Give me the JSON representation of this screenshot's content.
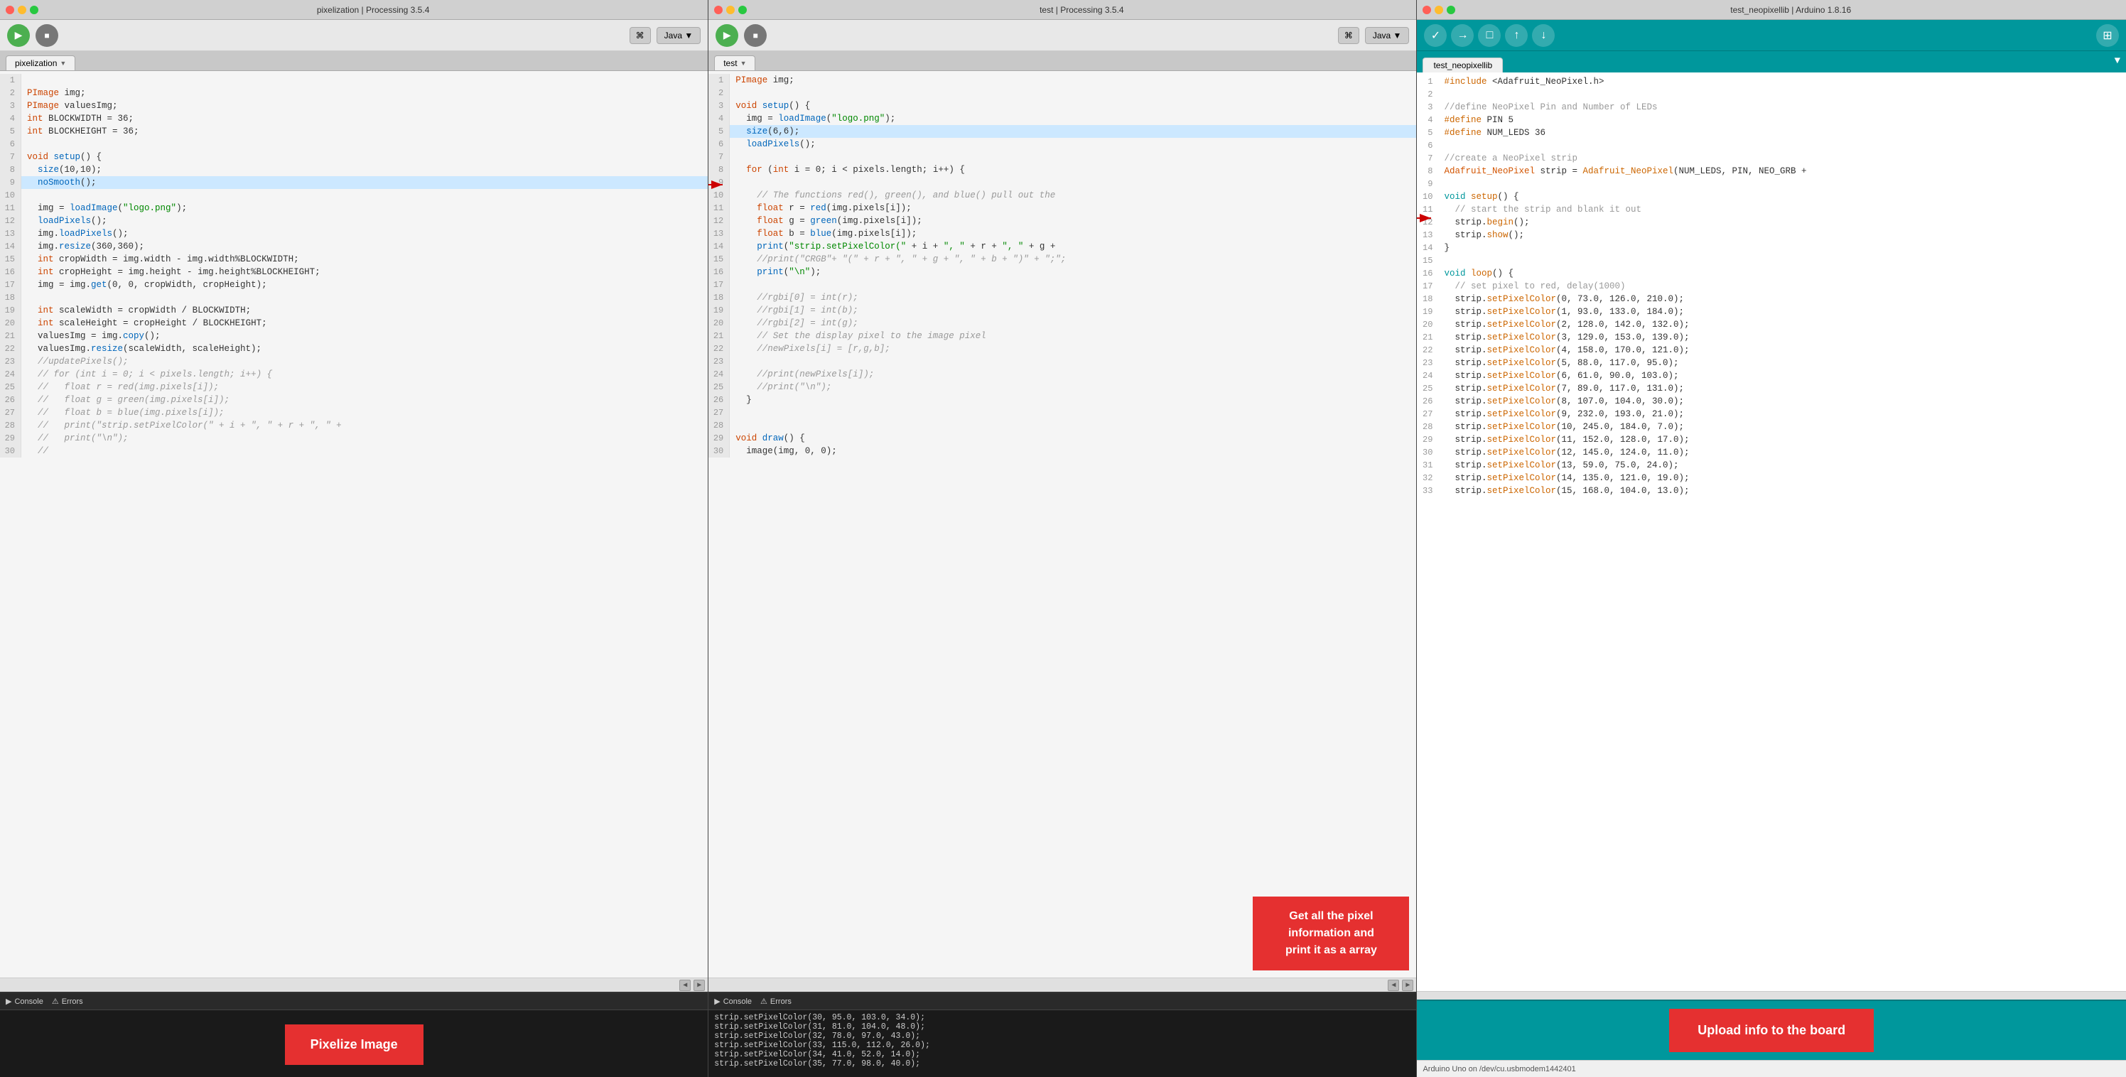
{
  "panels": [
    {
      "id": "processing-left",
      "titlebar": "pixelization | Processing 3.5.4",
      "tab": "pixelization",
      "lang": "Java",
      "lines": [
        {
          "n": 1,
          "text": ""
        },
        {
          "n": 2,
          "text": "PImage img;"
        },
        {
          "n": 3,
          "text": "PImage valuesImg;"
        },
        {
          "n": 4,
          "text": "int BLOCKWIDTH = 36;"
        },
        {
          "n": 5,
          "text": "int BLOCKHEIGHT = 36;"
        },
        {
          "n": 6,
          "text": ""
        },
        {
          "n": 7,
          "text": "void setup() {"
        },
        {
          "n": 8,
          "text": "  size(10,10);"
        },
        {
          "n": 9,
          "text": "  noSmooth();",
          "highlighted": true
        },
        {
          "n": 10,
          "text": ""
        },
        {
          "n": 11,
          "text": "  img = loadImage(\"logo.png\");"
        },
        {
          "n": 12,
          "text": "  loadPixels();"
        },
        {
          "n": 13,
          "text": "  img.loadPixels();"
        },
        {
          "n": 14,
          "text": "  img.resize(360,360);"
        },
        {
          "n": 15,
          "text": "  int cropWidth = img.width - img.width%BLOCKWIDTH;"
        },
        {
          "n": 16,
          "text": "  int cropHeight = img.height - img.height%BLOCKHEIGHT;"
        },
        {
          "n": 17,
          "text": "  img = img.get(0, 0, cropWidth, cropHeight);"
        },
        {
          "n": 18,
          "text": ""
        },
        {
          "n": 19,
          "text": "  int scaleWidth = cropWidth / BLOCKWIDTH;"
        },
        {
          "n": 20,
          "text": "  int scaleHeight = cropHeight / BLOCKHEIGHT;"
        },
        {
          "n": 21,
          "text": "  valuesImg = img.copy();"
        },
        {
          "n": 22,
          "text": "  valuesImg.resize(scaleWidth, scaleHeight);"
        },
        {
          "n": 23,
          "text": "  //updatePixels();"
        },
        {
          "n": 24,
          "text": "  // for (int i = 0; i < pixels.length; i++) {"
        },
        {
          "n": 25,
          "text": "  //   float r = red(img.pixels[i]);"
        },
        {
          "n": 26,
          "text": "  //   float g = green(img.pixels[i]);"
        },
        {
          "n": 27,
          "text": "  //   float b = blue(img.pixels[i]);"
        },
        {
          "n": 28,
          "text": "  //   print(\"strip.setPixelColor(\" + i + \", \" + r + \", \" +"
        },
        {
          "n": 29,
          "text": "  //   print(\"\\n\");"
        },
        {
          "n": 30,
          "text": "  //"
        }
      ]
    },
    {
      "id": "processing-mid",
      "titlebar": "test | Processing 3.5.4",
      "tab": "test",
      "lang": "Java",
      "lines": [
        {
          "n": 1,
          "text": "PImage img;"
        },
        {
          "n": 2,
          "text": ""
        },
        {
          "n": 3,
          "text": "void setup() {"
        },
        {
          "n": 4,
          "text": "  img = loadImage(\"logo.png\");"
        },
        {
          "n": 5,
          "text": "  size(6,6);",
          "highlighted": true
        },
        {
          "n": 6,
          "text": "  loadPixels();"
        },
        {
          "n": 7,
          "text": ""
        },
        {
          "n": 8,
          "text": "  for (int i = 0; i < pixels.length; i++) {"
        },
        {
          "n": 9,
          "text": ""
        },
        {
          "n": 10,
          "text": "    // The functions red(), green(), and blue() pull out the"
        },
        {
          "n": 11,
          "text": "    float r = red(img.pixels[i]);"
        },
        {
          "n": 12,
          "text": "    float g = green(img.pixels[i]);"
        },
        {
          "n": 13,
          "text": "    float b = blue(img.pixels[i]);"
        },
        {
          "n": 14,
          "text": "    print(\"strip.setPixelColor(\" + i + \", \" + r + \", \" + g +"
        },
        {
          "n": 15,
          "text": "    //print(\"CRGB\"+ \"(\" + r + \", \" + g + \", \" + b + \")\" + \";\";"
        },
        {
          "n": 16,
          "text": "    print(\"\\n\");"
        },
        {
          "n": 17,
          "text": ""
        },
        {
          "n": 18,
          "text": "    //rgbi[0] = int(r);"
        },
        {
          "n": 19,
          "text": "    //rgbi[1] = int(b);"
        },
        {
          "n": 20,
          "text": "    //rgbi[2] = int(g);"
        },
        {
          "n": 21,
          "text": "    // Set the display pixel to the image pixel"
        },
        {
          "n": 22,
          "text": "    //newPixels[i] = [r,g,b];"
        },
        {
          "n": 23,
          "text": ""
        },
        {
          "n": 24,
          "text": "    //print(newPixels[i]);"
        },
        {
          "n": 25,
          "text": "    //print(\"\\n\");"
        },
        {
          "n": 26,
          "text": "  }"
        },
        {
          "n": 27,
          "text": ""
        },
        {
          "n": 28,
          "text": ""
        },
        {
          "n": 29,
          "text": "void draw() {"
        },
        {
          "n": 30,
          "text": "  image(img, 0, 0);"
        }
      ],
      "annotation": "Get all the pixel\ninformation and\nprint it as a array",
      "console_lines": [
        "strip.setPixelColor(30, 95.0, 103.0, 34.0);",
        "strip.setPixelColor(31, 81.0, 104.0, 48.0);",
        "strip.setPixelColor(32, 78.0, 97.0, 43.0);",
        "strip.setPixelColor(33, 115.0, 112.0, 26.0);",
        "strip.setPixelColor(34, 41.0, 52.0, 14.0);",
        "strip.setPixelColor(35, 77.0, 98.0, 40.0);"
      ]
    }
  ],
  "arduino": {
    "titlebar": "test_neopixellib | Arduino 1.8.16",
    "tab": "test_neopixellib",
    "lines": [
      {
        "n": 1,
        "text": "#include <Adafruit_NeoPixel.h>"
      },
      {
        "n": 2,
        "text": ""
      },
      {
        "n": 3,
        "text": "//define NeoPixel Pin and Number of LEDs"
      },
      {
        "n": 4,
        "text": "#define PIN 5"
      },
      {
        "n": 5,
        "text": "#define NUM_LEDS 36"
      },
      {
        "n": 6,
        "text": ""
      },
      {
        "n": 7,
        "text": "//create a NeoPixel strip"
      },
      {
        "n": 8,
        "text": "Adafruit_NeoPixel strip = Adafruit_NeoPixel(NUM_LEDS, PIN, NEO_GRB +"
      },
      {
        "n": 9,
        "text": ""
      },
      {
        "n": 10,
        "text": "void setup() {"
      },
      {
        "n": 11,
        "text": "  // start the strip and blank it out"
      },
      {
        "n": 12,
        "text": "  strip.begin();"
      },
      {
        "n": 13,
        "text": "  strip.show();"
      },
      {
        "n": 14,
        "text": "}"
      },
      {
        "n": 15,
        "text": ""
      },
      {
        "n": 16,
        "text": "void loop() {"
      },
      {
        "n": 17,
        "text": "  // set pixel to red, delay(1000)"
      },
      {
        "n": 18,
        "text": "  strip.setPixelColor(0, 73.0, 126.0, 210.0);"
      },
      {
        "n": 19,
        "text": "  strip.setPixelColor(1, 93.0, 133.0, 184.0);"
      },
      {
        "n": 20,
        "text": "  strip.setPixelColor(2, 128.0, 142.0, 132.0);"
      },
      {
        "n": 21,
        "text": "  strip.setPixelColor(3, 129.0, 153.0, 139.0);"
      },
      {
        "n": 22,
        "text": "  strip.setPixelColor(4, 158.0, 170.0, 121.0);"
      },
      {
        "n": 23,
        "text": "  strip.setPixelColor(5, 88.0, 117.0, 95.0);"
      },
      {
        "n": 24,
        "text": "  strip.setPixelColor(6, 61.0, 90.0, 103.0);"
      },
      {
        "n": 25,
        "text": "  strip.setPixelColor(7, 89.0, 117.0, 131.0);"
      },
      {
        "n": 26,
        "text": "  strip.setPixelColor(8, 107.0, 104.0, 30.0);"
      },
      {
        "n": 27,
        "text": "  strip.setPixelColor(9, 232.0, 193.0, 21.0);"
      },
      {
        "n": 28,
        "text": "  strip.setPixelColor(10, 245.0, 184.0, 7.0);"
      },
      {
        "n": 29,
        "text": "  strip.setPixelColor(11, 152.0, 128.0, 17.0);"
      },
      {
        "n": 30,
        "text": "  strip.setPixelColor(12, 145.0, 124.0, 11.0);"
      },
      {
        "n": 31,
        "text": "  strip.setPixelColor(13, 59.0, 75.0, 24.0);"
      },
      {
        "n": 32,
        "text": "  strip.setPixelColor(14, 135.0, 121.0, 19.0);"
      },
      {
        "n": 33,
        "text": "  strip.setPixelColor(15, 168.0, 104.0, 13.0);"
      }
    ],
    "status_bar": "Arduino Uno on /dev/cu.usbmodem1442401",
    "upload_button": "Upload info to the board"
  },
  "buttons": {
    "play_title": "▶",
    "stop_title": "■",
    "pixelize_label": "Pixelize Image",
    "upload_label": "Upload info to the board",
    "console_label": "Console",
    "errors_label": "Errors",
    "debug_label": "⌘",
    "java_label": "Java ▼"
  }
}
